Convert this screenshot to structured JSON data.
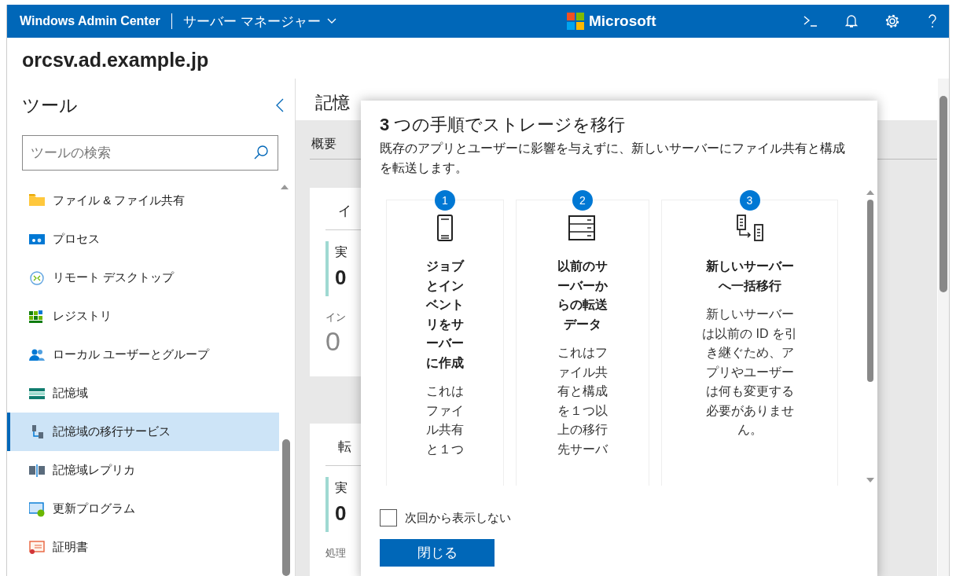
{
  "top_bar": {
    "product": "Windows Admin Center",
    "app_menu": "サーバー マネージャー",
    "brand": "Microsoft"
  },
  "server_name": "orcsv.ad.example.jp",
  "tools": {
    "title": "ツール",
    "search": {
      "placeholder": "ツールの検索"
    },
    "items": [
      {
        "label": "ファイル & ファイル共有",
        "kind": "folder",
        "selected": false
      },
      {
        "label": "プロセス",
        "kind": "process",
        "selected": false
      },
      {
        "label": "リモート デスクトップ",
        "kind": "remote",
        "selected": false
      },
      {
        "label": "レジストリ",
        "kind": "registry",
        "selected": false
      },
      {
        "label": "ローカル ユーザーとグループ",
        "kind": "users",
        "selected": false
      },
      {
        "label": "記憶域",
        "kind": "storage",
        "selected": false
      },
      {
        "label": "記憶域の移行サービス",
        "kind": "migration",
        "selected": true
      },
      {
        "label": "記憶域レプリカ",
        "kind": "replica",
        "selected": false
      },
      {
        "label": "更新プログラム",
        "kind": "update",
        "selected": false
      },
      {
        "label": "証明書",
        "kind": "certificate",
        "selected": false
      }
    ]
  },
  "page": {
    "title": "記憶",
    "tabs": [
      {
        "label": "概要"
      }
    ],
    "cards": [
      {
        "heading": "イ",
        "stat_label": "実",
        "stat_value": "0",
        "note": "イン",
        "note_value": "0"
      },
      {
        "heading": "転",
        "stat_label": "実",
        "stat_value": "0",
        "note": "処理"
      }
    ]
  },
  "dialog": {
    "title": "**3** つの手順でストレージを移行",
    "description": "既存のアプリとユーザーに影響を与えずに、新しいサーバーにファイル共有と構成を転送します。",
    "steps": [
      {
        "number": "1",
        "kind": "device",
        "title": "ジョブとインベントリをサーバーに作成",
        "body": "これはファイル共有と１つ"
      },
      {
        "number": "2",
        "kind": "server",
        "title": "以前のサーバーからの転送データ",
        "body": "これはファイル共有と構成を１つ以上の移行先サーバ"
      },
      {
        "number": "3",
        "kind": "transfer",
        "title": "新しいサーバーへ一括移行",
        "body": "新しいサーバーは以前の ID を引き継ぐため、アプリやユーザーは何も変更する必要がありません。"
      }
    ],
    "dont_show": {
      "label": "次回から表示しない",
      "checked": false
    },
    "close": "閉じる"
  }
}
